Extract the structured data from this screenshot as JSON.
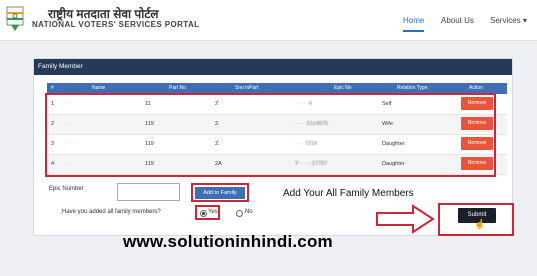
{
  "header": {
    "brand_hindi": "राष्ट्रीय मतदाता सेवा पोर्टल",
    "brand_english": "NATIONAL VOTERS' SERVICES PORTAL",
    "nav": [
      "Home",
      "About Us",
      "Services ▾"
    ]
  },
  "panel": {
    "title": "Family Member",
    "columns": [
      "#",
      "Name",
      "Part No",
      "Sno inPart",
      "Epic No",
      "Relation Type",
      "Action"
    ],
    "rows": [
      {
        "num": "1",
        "name": "·  ·",
        "part": "11",
        "sno": "2",
        "epic": "        ·  ·  ··  ·4",
        "relation": "Self",
        "action": "Remove"
      },
      {
        "num": "2",
        "name": "·  ·",
        "part": "119",
        "sno": "2.",
        "epic": "·  ·  ·  ·5114575",
        "relation": "Wife",
        "action": "Remove"
      },
      {
        "num": "3",
        "name": "·  ·  ·",
        "part": "119",
        "sno": "2.",
        "epic": "·  ·  ·  7219",
        "relation": "Daughter",
        "action": "Remove"
      },
      {
        "num": "4",
        "name": "·  ·",
        "part": "119",
        "sno": "2A",
        "epic": "Y  ·  ·  ·  ·27707",
        "relation": "Daughter",
        "action": "Remove"
      }
    ]
  },
  "form": {
    "epic_label": "Epic Number",
    "epic_value": "",
    "add_button": "Add to Family",
    "info_text": "Add Your All Family Members",
    "question": "Have you added all family members?",
    "yes_label": "Yes",
    "no_label": "No",
    "selected": "Yes",
    "submit_button": "Submit"
  },
  "watermark": "www.solutioninhindi.com",
  "colors": {
    "header_bar": "#243a56",
    "table_header": "#3e6fb5",
    "remove_button": "#e8553a",
    "highlight_border": "#c92a3a",
    "submit_button": "#1b1f27",
    "nav_active": "#2a6fb8"
  }
}
